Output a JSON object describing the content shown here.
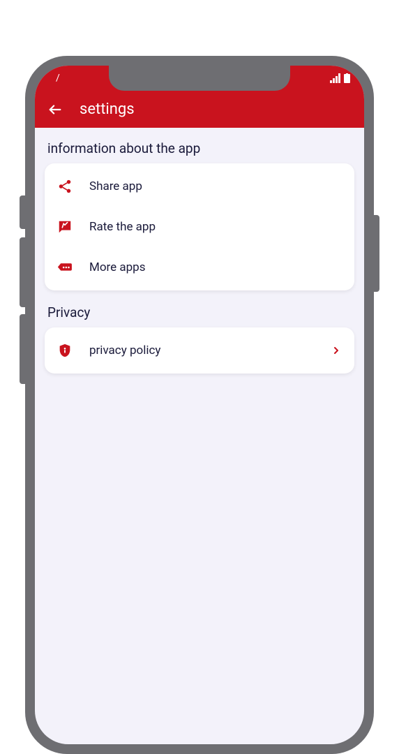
{
  "colors": {
    "accent": "#c9131e",
    "bg": "#f3f2fa",
    "text": "#1a1a3a"
  },
  "header": {
    "title": "settings"
  },
  "sections": [
    {
      "header": "information about the app",
      "items": [
        {
          "icon": "share-icon",
          "label": "Share app"
        },
        {
          "icon": "rate-icon",
          "label": "Rate the app"
        },
        {
          "icon": "more-apps-icon",
          "label": "More apps"
        }
      ]
    },
    {
      "header": "Privacy",
      "items": [
        {
          "icon": "shield-icon",
          "label": "privacy policy",
          "chevron": true
        }
      ]
    }
  ]
}
